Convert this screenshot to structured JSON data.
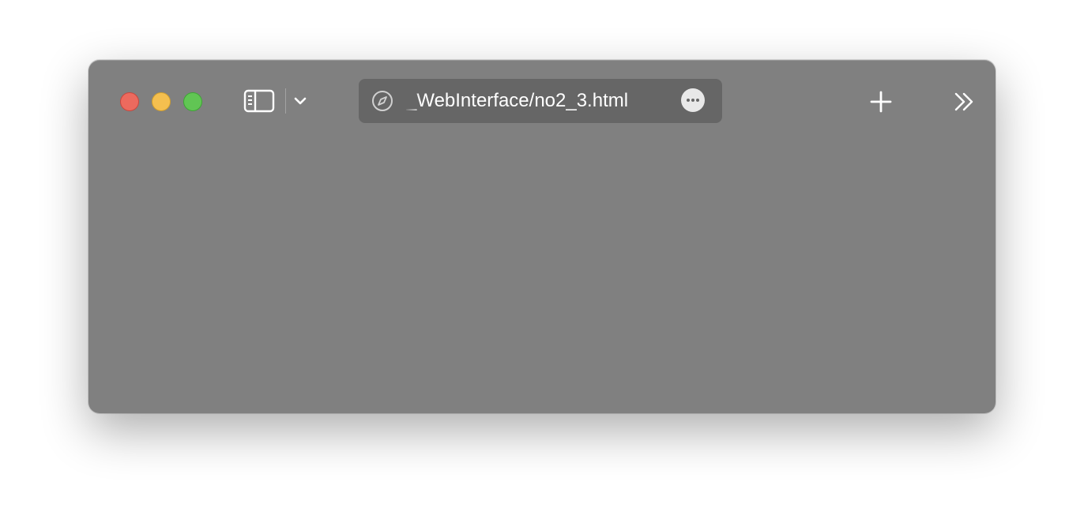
{
  "window": {
    "background_color": "#808080"
  },
  "traffic_lights": {
    "close_color": "#ec6a5e",
    "minimize_color": "#f4bf4f",
    "maximize_color": "#61c554"
  },
  "toolbar": {
    "sidebar_icon": "sidebar-icon",
    "tab_group_icon": "chevron-down-icon",
    "new_tab_icon": "plus-icon",
    "overflow_icon": "double-chevron-right-icon"
  },
  "address_bar": {
    "icon": "compass-icon",
    "url": "_WebInterface/no2_3.html",
    "more_icon": "ellipsis-icon"
  }
}
